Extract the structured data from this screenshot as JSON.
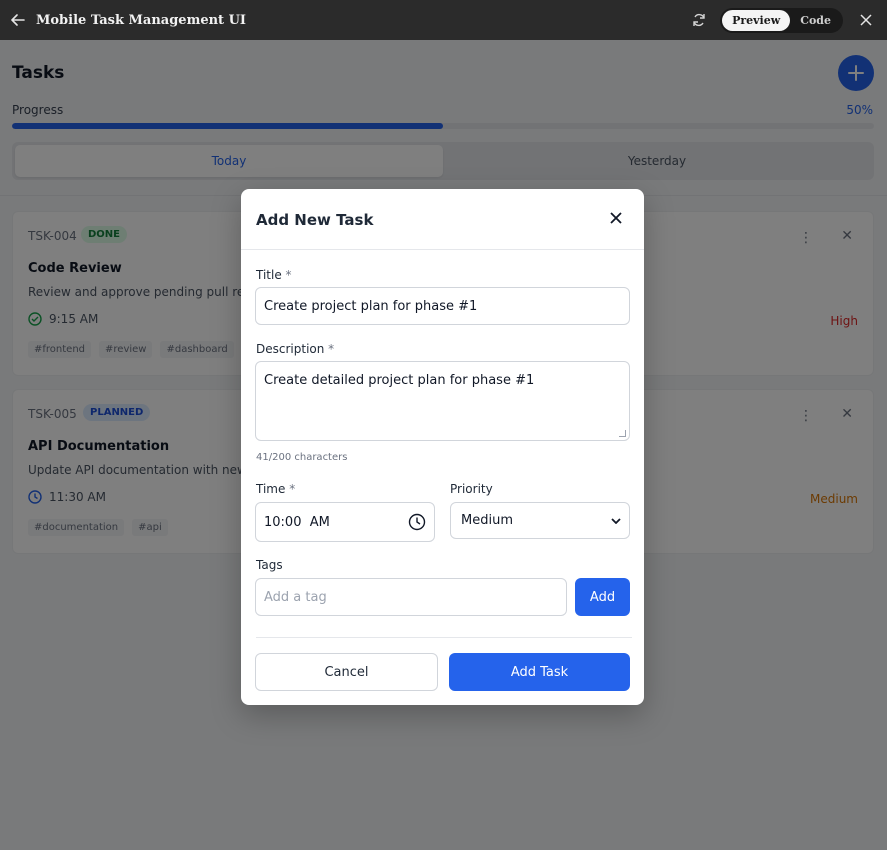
{
  "window": {
    "title": "Mobile Task Management UI",
    "toggle": {
      "preview": "Preview",
      "code": "Code",
      "active": "Preview"
    },
    "icons": [
      "back-arrow-icon",
      "refresh-icon",
      "close-icon"
    ]
  },
  "header": {
    "title": "Tasks",
    "add_icon": "plus-icon"
  },
  "progress": {
    "label": "Progress",
    "percent_text": "50%",
    "value": 0.5,
    "color": "#2563eb"
  },
  "tabs": [
    {
      "label": "Today",
      "active": true
    },
    {
      "label": "Yesterday",
      "active": false
    }
  ],
  "tasks": [
    {
      "id": "TSK-004",
      "status": "DONE",
      "title": "Code Review",
      "description": "Review and approve pending pull requ",
      "time": "9:15 AM",
      "time_icon": "check-circle-icon",
      "tags": [
        "#frontend",
        "#review",
        "#dashboard"
      ],
      "priority": "High",
      "priority_color": "#dc2626"
    },
    {
      "id": "TSK-005",
      "status": "PLANNED",
      "title": "API Documentation",
      "description": "Update API documentation with new e",
      "time": "11:30 AM",
      "time_icon": "clock-icon",
      "tags": [
        "#documentation",
        "#api"
      ],
      "priority": "Medium",
      "priority_color": "#d97706"
    }
  ],
  "modal": {
    "title": "Add New Task",
    "title_label": "Title",
    "title_value": "Create project plan for phase #1",
    "description_label": "Description",
    "description_value": "Create detailed project plan for phase #1",
    "counter": "41/200 characters",
    "time_label": "Time",
    "time_value": "10:00  AM",
    "priority_label": "Priority",
    "priority_value": "Medium",
    "tags_label": "Tags",
    "tags_placeholder": "Add a tag",
    "add_tag_button": "Add",
    "cancel_button": "Cancel",
    "submit_button": "Add Task",
    "required_mark": "*"
  }
}
